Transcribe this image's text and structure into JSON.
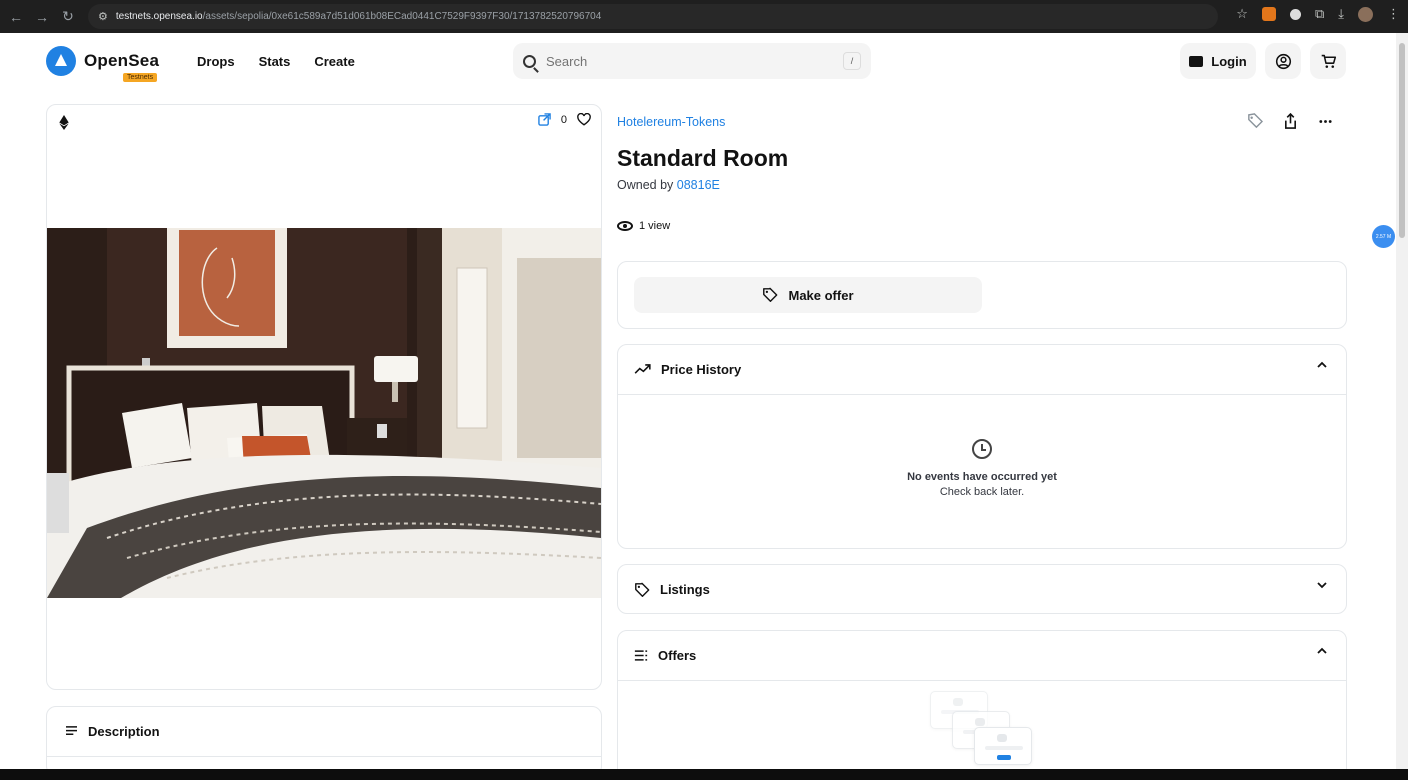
{
  "browser": {
    "url_host": "testnets.opensea.io",
    "url_path": "/assets/sepolia/0xe61c589a7d51d061b08ECad0441C7529F9397F30/1713782520796704"
  },
  "header": {
    "logo_text": "OpenSea",
    "testnets_badge": "Testnets",
    "nav": [
      "Drops",
      "Stats",
      "Create"
    ],
    "search_placeholder": "Search",
    "search_shortcut": "/",
    "login_label": "Login"
  },
  "asset": {
    "favorites_count": "0",
    "collection": "Hotelereum-Tokens",
    "title": "Standard Room",
    "owned_by_label": "Owned by",
    "owner": "08816E",
    "views": "1 view"
  },
  "actions": {
    "make_offer": "Make offer"
  },
  "panels": {
    "price_history": {
      "title": "Price History",
      "empty_title": "No events have occurred yet",
      "empty_sub": "Check back later."
    },
    "listings": {
      "title": "Listings"
    },
    "offers": {
      "title": "Offers"
    },
    "description": {
      "title": "Description"
    }
  },
  "floating_badge": "2.57 M",
  "colors": {
    "accent": "#2081e2",
    "testnets_badge": "#f5a623",
    "border": "#e5e8eb"
  }
}
